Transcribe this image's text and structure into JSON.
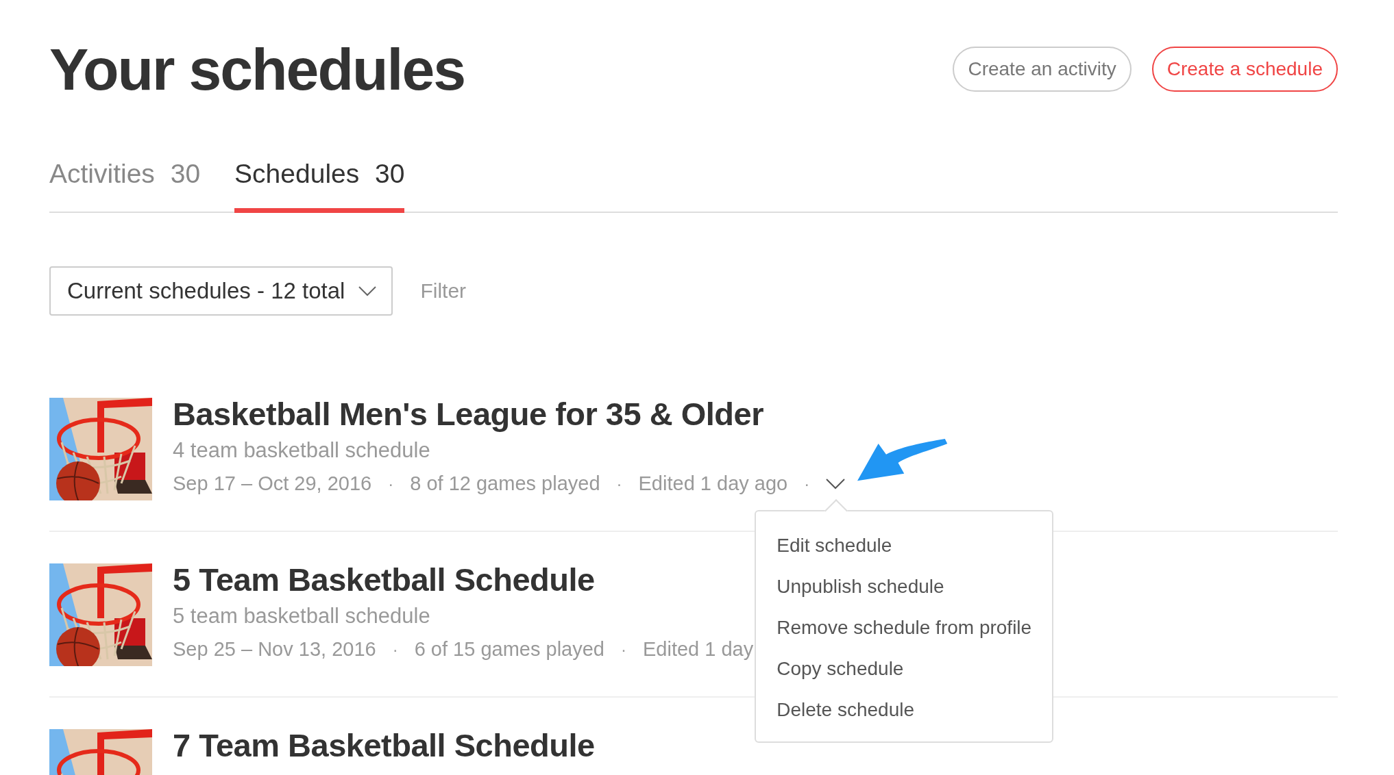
{
  "page_title": "Your schedules",
  "buttons": [
    {
      "label": "Create an activity",
      "kind": "secondary"
    },
    {
      "label": "Create a schedule",
      "kind": "primary"
    }
  ],
  "tabs": [
    {
      "label": "Activities",
      "count": "30",
      "selected": false
    },
    {
      "label": "Schedules",
      "count": "30",
      "selected": true
    }
  ],
  "dropdown": {
    "value": "Current schedules - 12 total"
  },
  "filter": {
    "placeholder": "Filter"
  },
  "schedules": [
    {
      "title": "Basketball Men's League for 35 & Older",
      "subtitle": "4 team basketball schedule",
      "meta": [
        {
          "kind": "value",
          "text": "Sep 17 – Oct 29, 2016"
        },
        {
          "kind": "separator",
          "text": "·"
        },
        {
          "kind": "value",
          "text": "8 of 12 games played"
        },
        {
          "kind": "separator",
          "text": "·"
        },
        {
          "kind": "value",
          "text": "Edited 1 day ago"
        },
        {
          "kind": "separator",
          "text": "·"
        }
      ],
      "expanded": true,
      "menu": [
        "Edit schedule",
        "Unpublish schedule",
        "Remove schedule from profile",
        "Copy schedule",
        "Delete schedule"
      ]
    },
    {
      "title": "5 Team Basketball Schedule",
      "subtitle": "5 team basketball schedule",
      "meta": [
        {
          "kind": "value",
          "text": "Sep 25 – Nov 13, 2016"
        },
        {
          "kind": "separator",
          "text": "·"
        },
        {
          "kind": "value",
          "text": "6 of 15 games played"
        },
        {
          "kind": "separator",
          "text": "·"
        },
        {
          "kind": "value",
          "text": "Edited 1 day"
        }
      ]
    },
    {
      "title": "7 Team Basketball Schedule"
    }
  ]
}
